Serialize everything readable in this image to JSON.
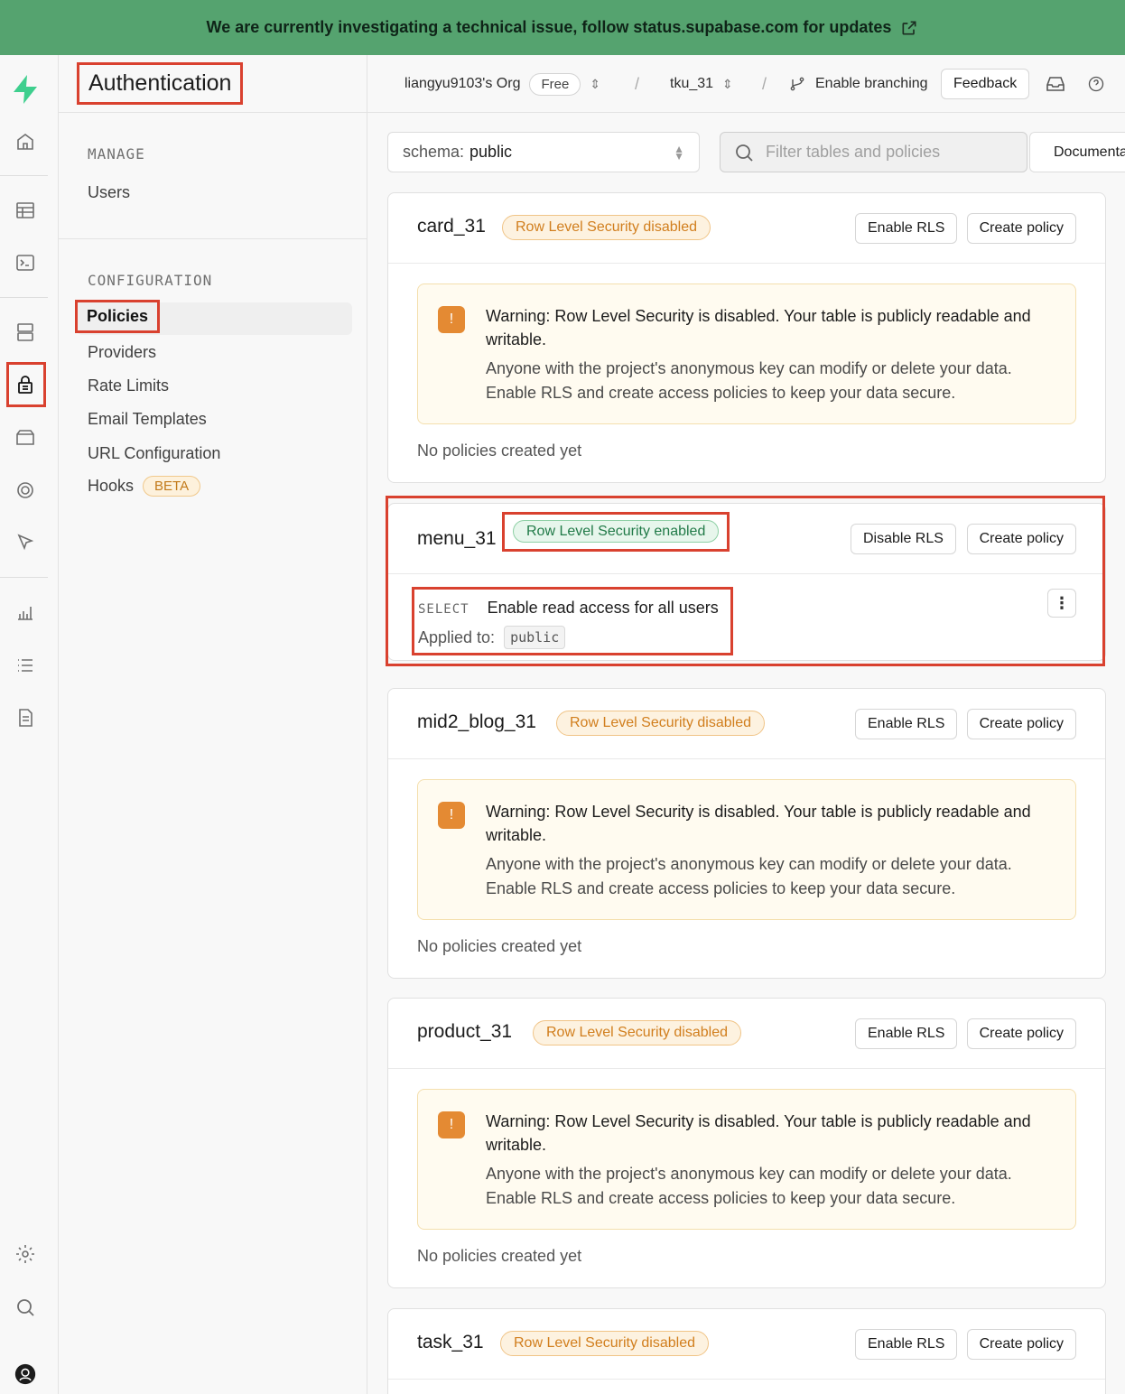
{
  "banner": {
    "text": "We are currently investigating a technical issue, follow status.supabase.com for updates"
  },
  "sidebar": {
    "title": "Authentication",
    "groups": [
      {
        "title": "MANAGE",
        "items": [
          {
            "label": "Users"
          }
        ]
      },
      {
        "title": "CONFIGURATION",
        "items": [
          {
            "label": "Policies",
            "active": true
          },
          {
            "label": "Providers"
          },
          {
            "label": "Rate Limits"
          },
          {
            "label": "Email Templates"
          },
          {
            "label": "URL Configuration"
          },
          {
            "label": "Hooks",
            "badge": "BETA"
          }
        ]
      }
    ]
  },
  "topbar": {
    "org": "liangyu9103's Org",
    "plan": "Free",
    "project": "tku_31",
    "branching": "Enable branching",
    "feedback": "Feedback"
  },
  "toolbar": {
    "schema_prefix": "schema:",
    "schema_value": "public",
    "filter_placeholder": "Filter tables and policies",
    "docs_label": "Documentation"
  },
  "warning": {
    "title": "Warning: Row Level Security is disabled. Your table is publicly readable and writable.",
    "body": "Anyone with the project's anonymous key can modify or delete your data. Enable RLS and create access policies to keep your data secure."
  },
  "tables": [
    {
      "name": "card_31",
      "rls_badge": "Row Level Security disabled",
      "rls_button": "Enable RLS",
      "create_button": "Create policy",
      "empty": "No policies created yet"
    },
    {
      "name": "menu_31",
      "rls_badge": "Row Level Security enabled",
      "rls_button": "Disable RLS",
      "create_button": "Create policy",
      "policy": {
        "command": "SELECT",
        "name": "Enable read access for all users",
        "applied_label": "Applied to:",
        "role": "public"
      }
    },
    {
      "name": "mid2_blog_31",
      "rls_badge": "Row Level Security disabled",
      "rls_button": "Enable RLS",
      "create_button": "Create policy",
      "empty": "No policies created yet"
    },
    {
      "name": "product_31",
      "rls_badge": "Row Level Security disabled",
      "rls_button": "Enable RLS",
      "create_button": "Create policy",
      "empty": "No policies created yet"
    },
    {
      "name": "task_31",
      "rls_badge": "Row Level Security disabled",
      "rls_button": "Enable RLS",
      "create_button": "Create policy"
    }
  ],
  "colors": {
    "banner": "#55a36f",
    "brand": "#3ecf8e",
    "highlight": "#d9412f",
    "warning": "#e48a33"
  }
}
